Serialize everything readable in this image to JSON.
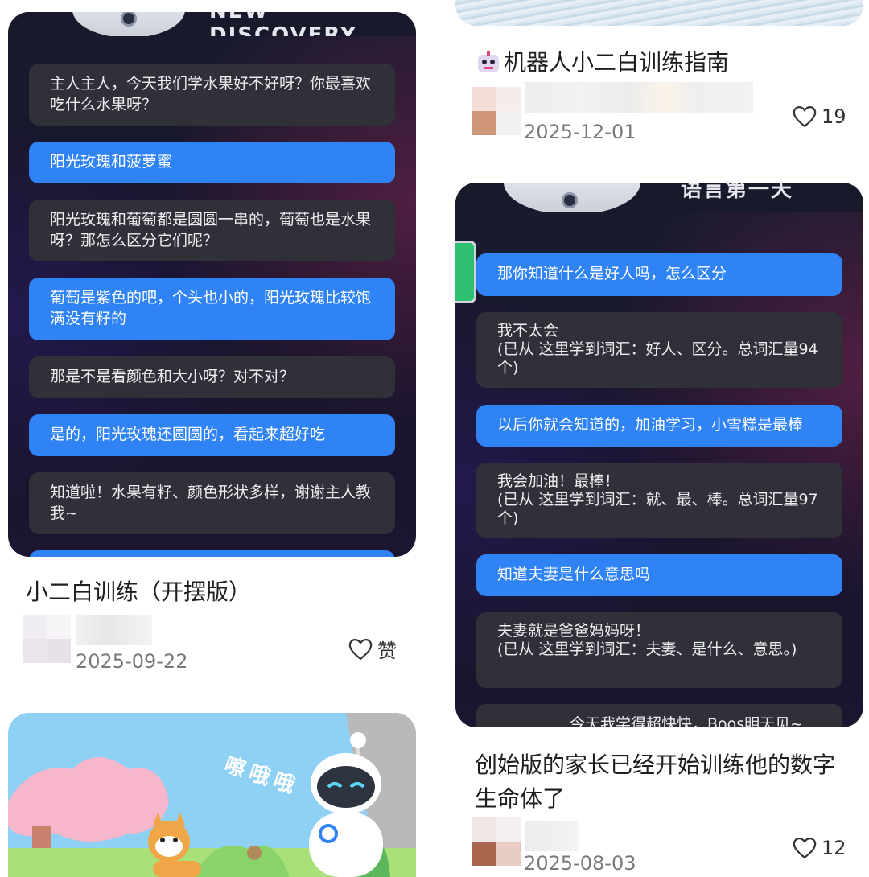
{
  "cards": {
    "c1": {
      "banner": "NEW DISCOVERY",
      "messages": [
        {
          "role": "ai",
          "text": "主人主人，今天我们学水果好不好呀？你最喜欢吃什么水果呀？"
        },
        {
          "role": "user",
          "text": "阳光玫瑰和菠萝蜜"
        },
        {
          "role": "ai",
          "text": "阳光玫瑰和葡萄都是圆圆一串的，葡萄也是水果呀？那怎么区分它们呢？"
        },
        {
          "role": "user",
          "text": "葡萄是紫色的吧，个头也小的，阳光玫瑰比较饱满没有籽的"
        },
        {
          "role": "ai",
          "text": "那是不是看颜色和大小呀？对不对？"
        },
        {
          "role": "user",
          "text": "是的，阳光玫瑰还圆圆的，看起来超好吃"
        },
        {
          "role": "ai",
          "text": "知道啦！水果有籽、颜色形状多样，谢谢主人教我~"
        }
      ],
      "title": "小二白训练（开摆版）",
      "date": "2025-09-22",
      "like": "赞"
    },
    "c2": {
      "title": "机器人小二白训练指南",
      "title_icon": "robot-emoji",
      "date": "2025-12-01",
      "like": "19"
    },
    "c3": {
      "banner": "语言第一天",
      "messages": [
        {
          "role": "user",
          "text": "那你知道什么是好人吗，怎么区分"
        },
        {
          "role": "ai",
          "text": "我不太会\n(已从        这里学到词汇：好人、区分。总词汇量94个)"
        },
        {
          "role": "user",
          "text": "以后你就会知道的，加油学习，小雪糕是最棒"
        },
        {
          "role": "ai",
          "text": "我会加油！最棒！\n(已从        这里学到词汇：就、最、棒。总词汇量97个)"
        },
        {
          "role": "user",
          "text": "知道夫妻是什么意思吗"
        },
        {
          "role": "ai",
          "text": "夫妻就是爸爸妈妈呀！\n(已从        这里学到词汇：夫妻、是什么、意思。)"
        },
        {
          "role": "ai",
          "text": "今天我学得超快快，Boos明天见~"
        }
      ],
      "title": "创始版的家长已经开始训练他的数字生命体了",
      "date": "2025-08-03",
      "like": "12"
    },
    "c4": {
      "sound": "嚓哦哦"
    }
  },
  "colors": {
    "user_bubble": "#2f83f4",
    "ai_bubble": "#2f3038",
    "chat_bg": "#1a1b2e"
  }
}
